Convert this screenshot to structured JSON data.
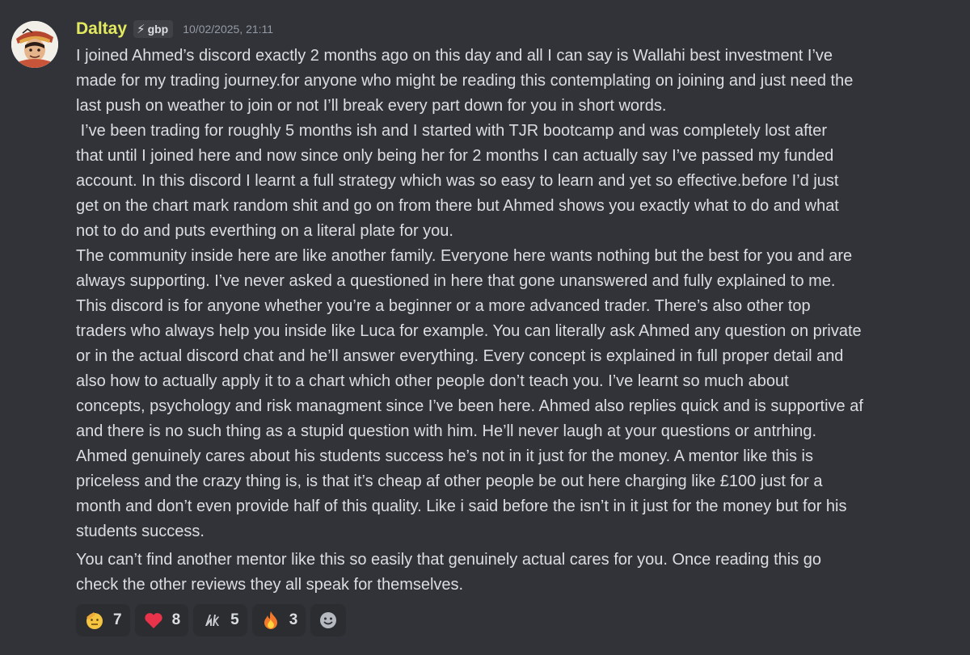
{
  "message": {
    "author": "Daltay",
    "guild_tag": "gbp",
    "timestamp": "10/02/2025, 21:11",
    "paragraph_1": "I joined Ahmed’s discord exactly 2 months ago on this day and all I can say is Wallahi best investment I’ve\nmade for my trading journey.for anyone who might be reading this contemplating on joining and just need the\nlast push on weather to join or not I’ll break every part down for you in short words.\n I’ve been trading for roughly 5 months ish and I started with TJR bootcamp and was completely lost after\nthat until I joined here and now since only being her for 2 months I can actually say I’ve passed my funded\naccount. In this discord I learnt a full strategy which was so easy to learn and yet so effective.before I’d just\nget on the chart mark random shit and go on from there but Ahmed shows you exactly what to do and what\nnot to do and puts everthing on a literal plate for you.\nThe community inside here are like another family. Everyone here wants nothing but the best for you and are\nalways supporting. I’ve never asked a questioned in here that gone unanswered and fully explained to me.\nThis discord is for anyone whether you’re a beginner or a more advanced trader. There’s also other top\ntraders who always help you inside like Luca for example. You can literally ask Ahmed any question on private\nor in the actual discord chat and he’ll answer everything. Every concept is explained in full proper detail and\nalso how to actually apply it to a chart which other people don’t teach you. I’ve learnt so much about\nconcepts, psychology and risk managment since I’ve been here. Ahmed also replies quick and is supportive af\nand there is no such thing as a stupid question with him. He’ll never laugh at your questions or antrhing.\nAhmed genuinely cares about his students success he’s not in it just for the money. A mentor like this is\npriceless and the crazy thing is, is that it’s cheap af other people be out here charging like £100 just for a\nmonth and don’t even provide half of this quality. Like i said before the isn’t in it just for the money but for his\nstudents success.",
    "paragraph_2": "You can’t find another mentor like this so easily that genuinely actual cares for you. Once reading this go\ncheck the other reviews they all speak for themselves."
  },
  "reactions": [
    {
      "icon": "salute-face-icon",
      "count": "7"
    },
    {
      "icon": "red-heart-icon",
      "count": "8"
    },
    {
      "icon": "custom-logo-icon",
      "count": "5"
    },
    {
      "icon": "fire-icon",
      "count": "3"
    }
  ],
  "colors": {
    "background": "#313338",
    "username": "#e3e95f",
    "text": "#dbdee1",
    "timestamp": "#949ba4",
    "reaction_bg": "#2b2d31"
  }
}
